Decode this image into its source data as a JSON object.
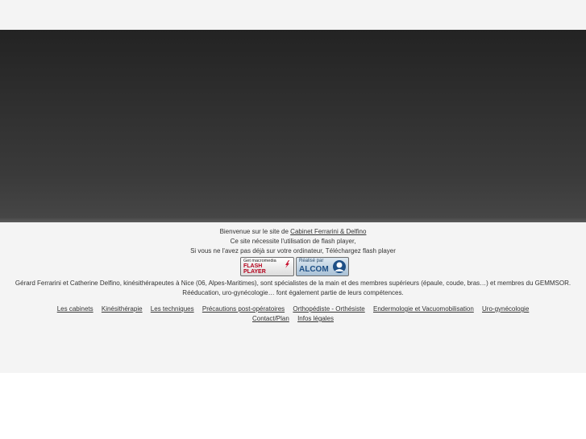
{
  "intro": {
    "welcome_prefix": "Bienvenue sur le site de ",
    "site_link": "Cabinet Ferrarini & Delfino",
    "flash_required": "Ce site nécessite l'utilisation de flash player,",
    "download_prompt": "Si vous ne l'avez pas déjà sur votre ordinateur, Téléchargez flash player"
  },
  "badges": {
    "flash": {
      "line1": "Get macromedia",
      "line2": "FLASH",
      "line3": "PLAYER",
      "icon": "flash-logo-icon"
    },
    "alcom": {
      "line1": "Réalisé par",
      "line2": "ALCOM",
      "icon": "alcom-logo-icon"
    }
  },
  "description": "Gérard Ferrarini et Catherine Delfino, kinésithérapeutes à Nice (06, Alpes-Maritimes), sont spécialistes de la main et des membres supérieurs (épaule, coude, bras…) et membres du GEMMSOR. Rééducation, uro-gynécologie… font également partie de leurs compétences.",
  "nav": {
    "row1": [
      "Les cabinets",
      "Kinésithérapie",
      "Les techniques",
      "Précautions post-opératoires",
      "Orthopédiste - Orthésiste",
      "Endermologie et Vacuomobilisation",
      "Uro-gynécologie"
    ],
    "row2": [
      "Contact/Plan",
      "Infos légales"
    ]
  },
  "colors": {
    "banner_top": "#232323",
    "banner_bottom": "#474747",
    "panel_bg": "#f4f4f4",
    "text": "#333333"
  }
}
